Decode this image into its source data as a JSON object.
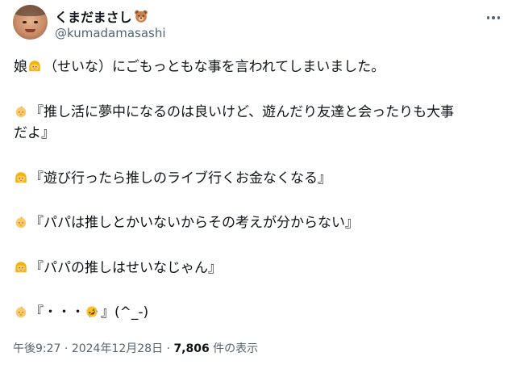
{
  "author": {
    "display_name": "くまだまさし",
    "name_emoji": "bear-face-icon",
    "handle": "@kumadamasashi"
  },
  "post": {
    "lines": [
      {
        "prefix": "娘",
        "emoji": "girl-emoji",
        "text": "（せいな）にごもっともな事を言われてしまいました。"
      },
      {
        "emoji": "baby-emoji",
        "text": "『推し活に夢中になるのは良いけど、遊んだり友達と会ったりも大事"
      },
      {
        "text": "だよ』"
      },
      {
        "emoji": "girl-emoji",
        "text": "『遊び行ったら推しのライブ行くお金なくなる』"
      },
      {
        "emoji": "baby-emoji",
        "text": "『パパは推しとかいないからその考えが分からない』"
      },
      {
        "emoji": "girl-emoji",
        "text": "『パパの推しはせいなじゃん』"
      },
      {
        "emoji": "baby-emoji",
        "text": "『・・・",
        "emoji2": "rolling-on-floor-laughing-emoji",
        "text2": "』(^_-)"
      }
    ]
  },
  "meta": {
    "time": "午後9:27",
    "sep1": " · ",
    "date": "2024年12月28日",
    "sep2": " · ",
    "views_count": "7,806",
    "views_label": " 件の表示"
  },
  "colors": {
    "text_primary": "#0f1419",
    "text_secondary": "#536471",
    "background": "#ffffff"
  }
}
